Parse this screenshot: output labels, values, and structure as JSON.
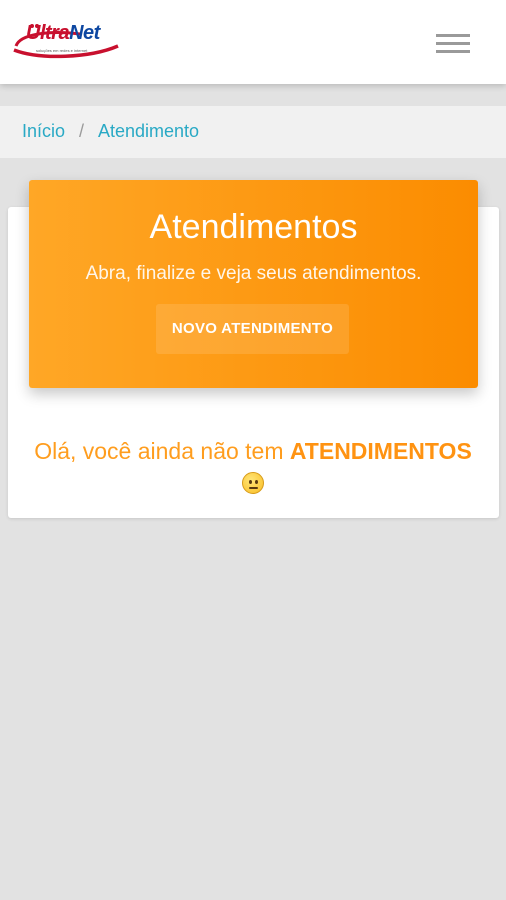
{
  "brand": {
    "logo_prefix": "Ultra",
    "logo_suffix": "Net",
    "logo_tagline": "soluções em redes e internet",
    "logo_colors": [
      "#c8102e",
      "#0d47a1"
    ]
  },
  "header": {
    "menu_icon": "hamburger-menu-icon"
  },
  "breadcrumb": {
    "home_label": "Início",
    "separator": "/",
    "current_label": "Atendimento",
    "link_color": "#29a9c5"
  },
  "hero": {
    "title": "Atendimentos",
    "subtitle": "Abra, finalize e veja seus atendimentos.",
    "button_label": "NOVO ATENDIMENTO",
    "gradient_colors": [
      "#ffa726",
      "#fb8c00"
    ]
  },
  "empty_state": {
    "message_prefix": "Olá, você ainda não tem ",
    "message_emphasis": "ATENDIMENTOS",
    "emoji_icon": "neutral-face-emoji-icon",
    "text_color": "#ff9d1e"
  }
}
